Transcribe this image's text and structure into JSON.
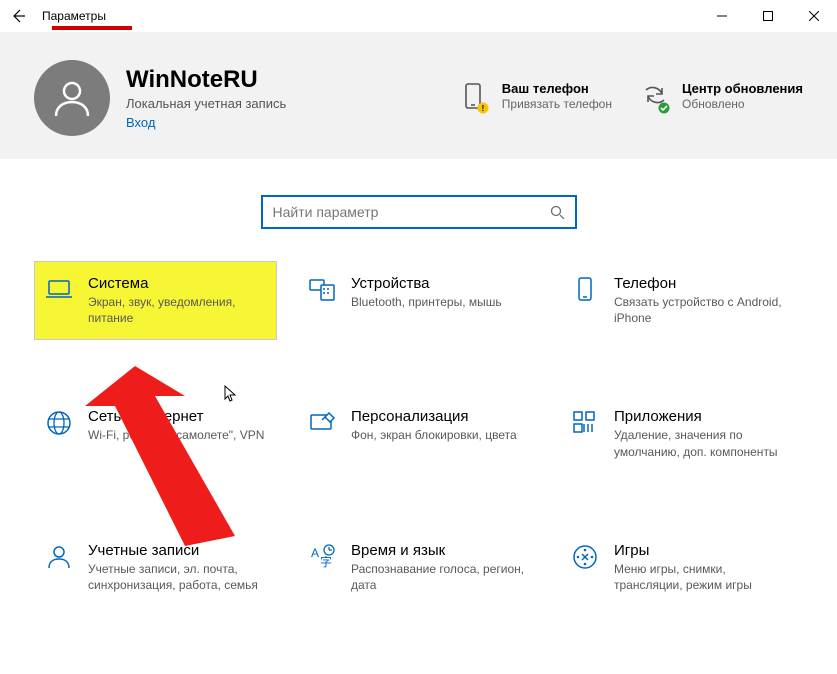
{
  "titlebar": {
    "title": "Параметры"
  },
  "account": {
    "name": "WinNoteRU",
    "subtitle": "Локальная учетная запись",
    "signin": "Вход"
  },
  "statuses": {
    "phone": {
      "title": "Ваш телефон",
      "sub": "Привязать телефон"
    },
    "update": {
      "title": "Центр обновления",
      "sub": "Обновлено"
    }
  },
  "search": {
    "placeholder": "Найти параметр"
  },
  "tiles": {
    "system": {
      "title": "Система",
      "sub": "Экран, звук, уведомления, питание"
    },
    "devices": {
      "title": "Устройства",
      "sub": "Bluetooth, принтеры, мышь"
    },
    "phone": {
      "title": "Телефон",
      "sub": "Связать устройство с Android, iPhone"
    },
    "network": {
      "title": "Сеть и Интернет",
      "sub": "Wi-Fi, режим \"в самолете\", VPN"
    },
    "personal": {
      "title": "Персонализация",
      "sub": "Фон, экран блокировки, цвета"
    },
    "apps": {
      "title": "Приложения",
      "sub": "Удаление, значения по умолчанию, доп. компоненты"
    },
    "accounts": {
      "title": "Учетные записи",
      "sub": "Учетные записи, эл. почта, синхронизация, работа, семья"
    },
    "time": {
      "title": "Время и язык",
      "sub": "Распознавание голоса, регион, дата"
    },
    "games": {
      "title": "Игры",
      "sub": "Меню игры, снимки, трансляции, режим игры"
    }
  }
}
